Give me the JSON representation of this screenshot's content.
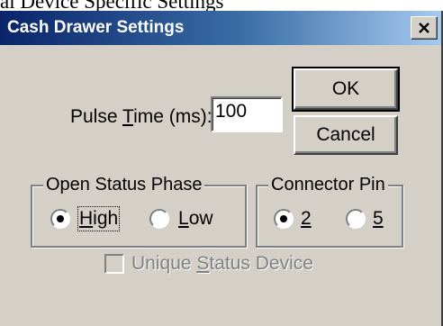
{
  "page": {
    "caption": "al Device Specific Settings"
  },
  "window": {
    "title": "Cash Drawer Settings",
    "close_symbol": "×"
  },
  "pulse": {
    "label_prefix": "Pulse ",
    "label_mnemonic": "T",
    "label_suffix": "ime (ms):",
    "value": "100"
  },
  "buttons": {
    "ok": "OK",
    "cancel": "Cancel"
  },
  "open_status_phase": {
    "title": "Open Status Phase",
    "options": [
      {
        "mnemonic": "H",
        "rest": "igh",
        "selected": true
      },
      {
        "mnemonic": "L",
        "rest": "ow",
        "selected": false
      }
    ]
  },
  "connector_pin": {
    "title": "Connector Pin",
    "options": [
      {
        "mnemonic": "2",
        "rest": "",
        "selected": true
      },
      {
        "mnemonic": "5",
        "rest": "",
        "selected": false
      }
    ]
  },
  "unique_status": {
    "label_prefix": "Unique ",
    "label_mnemonic": "S",
    "label_suffix": "tatus Device",
    "checked": false,
    "enabled": false
  }
}
